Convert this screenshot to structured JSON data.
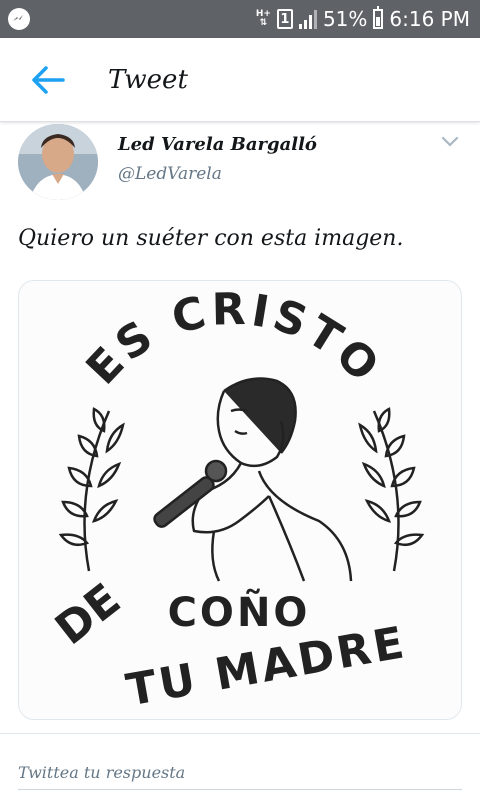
{
  "status_bar": {
    "network_type": "H+",
    "sim_slot": "1",
    "battery": "51%",
    "time": "6:16 PM",
    "icons": [
      "messenger-icon",
      "network-icon",
      "sim-icon",
      "signal-icon",
      "battery-icon"
    ]
  },
  "app_bar": {
    "title": "Tweet",
    "back_icon": "arrow-left-icon"
  },
  "tweet": {
    "author_name": "Led Varela Bargalló",
    "author_handle": "@LedVarela",
    "text": "Quiero un suéter con esta imagen.",
    "menu_icon": "chevron-down-icon",
    "media": {
      "top_text": "ES CRISTO",
      "bottom_text_1": "DE",
      "bottom_text_2": "COÑO",
      "bottom_text_3": "TU MADRE"
    }
  },
  "reply": {
    "placeholder": "Twittea tu respuesta"
  },
  "colors": {
    "status_bar_bg": "#5f6368",
    "accent": "#1da1f2",
    "text_primary": "#14171a",
    "text_secondary": "#657786"
  }
}
